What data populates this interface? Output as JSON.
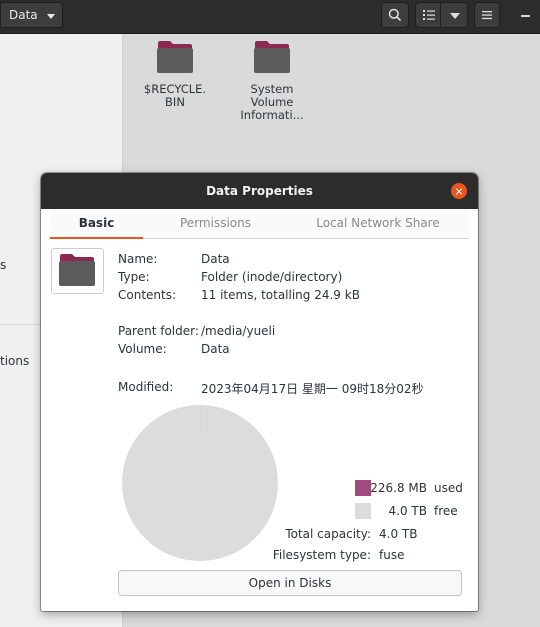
{
  "file_manager": {
    "path_label": "Data",
    "sidebar_fragments": [
      "s",
      "tions"
    ],
    "files": [
      {
        "name": "$RECYCLE.\nBIN"
      },
      {
        "name": "System\nVolume\nInformati..."
      }
    ]
  },
  "dialog": {
    "title": "Data Properties",
    "tabs": [
      {
        "label": "Basic"
      },
      {
        "label": "Permissions"
      },
      {
        "label": "Local Network Share"
      }
    ],
    "fields": {
      "name_label": "Name:",
      "name_value": "Data",
      "type_label": "Type:",
      "type_value": "Folder (inode/directory)",
      "contents_label": "Contents:",
      "contents_value": "11 items, totalling 24.9 kB",
      "parent_label": "Parent folder:",
      "parent_value": "/media/yueli",
      "volume_label": "Volume:",
      "volume_value": "Data",
      "modified_label": "Modified:",
      "modified_value": "2023年04月17日 星期一 09时18分02秒"
    },
    "usage": {
      "used_size": "226.8 MB",
      "used_word": "used",
      "free_size": "4.0 TB",
      "free_word": "free",
      "total_label": "Total capacity:",
      "total_value": "4.0 TB",
      "fs_label": "Filesystem type:",
      "fs_value": "fuse",
      "used_fraction": 5.67e-05
    },
    "open_button": "Open in Disks"
  },
  "colors": {
    "accent": "#e95420",
    "used": "#a04a7e",
    "free": "#dcdcdc",
    "folder_top": "#8c2a52",
    "folder_body": "#5c5c5c"
  }
}
